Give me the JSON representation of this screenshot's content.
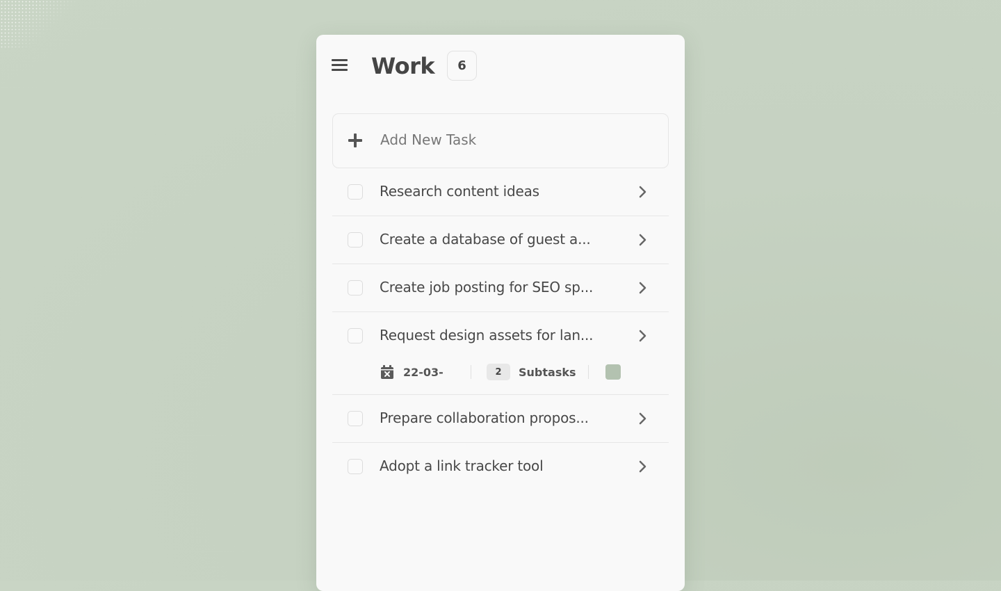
{
  "list": {
    "title": "Work",
    "count": "6"
  },
  "add_task": {
    "placeholder": "Add New Task"
  },
  "tasks": [
    {
      "title": "Research content ideas",
      "checked": false
    },
    {
      "title": "Create a database of guest a...",
      "checked": false
    },
    {
      "title": "Create job posting for SEO sp...",
      "checked": false
    },
    {
      "title": "Request design assets for lan...",
      "checked": false,
      "meta": {
        "date": "22-03-",
        "subtask_count": "2",
        "subtask_label": "Subtasks",
        "list_color": "#b3c2b0"
      }
    },
    {
      "title": "Prepare collaboration propos...",
      "checked": false
    },
    {
      "title": "Adopt a link tracker tool",
      "checked": false
    }
  ],
  "icons": {
    "menu": "hamburger-menu-icon",
    "add": "plus-icon",
    "row_action": "chevron-right-icon",
    "due_date": "calendar-x-icon"
  },
  "colors": {
    "background": "#c9d5c5",
    "card": "#f9f9f9",
    "text": "#484848",
    "tag": "#b3c2b0"
  }
}
